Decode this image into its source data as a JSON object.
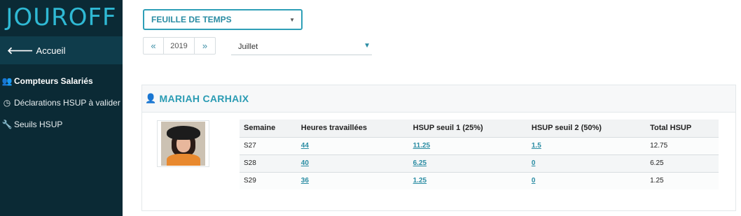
{
  "app": {
    "brand": "JOUROFF"
  },
  "sidebar": {
    "home_label": "Accueil",
    "items": [
      {
        "label": "Compteurs Salariés",
        "icon": "users-icon",
        "active": true
      },
      {
        "label": "Déclarations HSUP à valider",
        "icon": "clock-icon",
        "active": false
      },
      {
        "label": "Seuils HSUP",
        "icon": "wrench-icon",
        "active": false
      }
    ]
  },
  "toolbar": {
    "mode": "FEUILLE DE TEMPS",
    "year": "2019",
    "prev_label": "«",
    "next_label": "»",
    "month": "Juillet"
  },
  "employee": {
    "name": "MARIAH CARHAIX"
  },
  "table": {
    "headers": [
      "Semaine",
      "Heures travaillées",
      "HSUP seuil 1 (25%)",
      "HSUP seuil 2 (50%)",
      "Total HSUP"
    ],
    "rows": [
      [
        "S27",
        "44",
        "11.25",
        "1.5",
        "12.75"
      ],
      [
        "S28",
        "40",
        "6.25",
        "0",
        "6.25"
      ],
      [
        "S29",
        "36",
        "1.25",
        "0",
        "1.25"
      ]
    ]
  },
  "colors": {
    "sidebar_bg": "#0b2a35",
    "accent": "#2a9bb3"
  }
}
